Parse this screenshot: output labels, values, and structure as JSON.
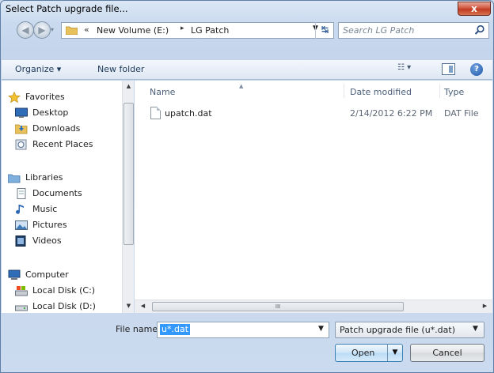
{
  "window": {
    "title": "Select Patch upgrade file...",
    "close_glyph": "x"
  },
  "nav": {
    "back_glyph": "◀",
    "forward_glyph": "▶",
    "address": {
      "overflow": "«",
      "segments": [
        "New Volume (E:)",
        "LG Patch"
      ],
      "separator": "▸"
    },
    "refresh_glyph": "↹",
    "search_placeholder": "Search LG Patch"
  },
  "toolbar": {
    "organize_label": "Organize ▾",
    "new_folder_label": "New folder",
    "views_glyph": "☷ ▾",
    "help_glyph": "?"
  },
  "sidebar": {
    "favorites": {
      "label": "Favorites",
      "items": [
        "Desktop",
        "Downloads",
        "Recent Places"
      ]
    },
    "libraries": {
      "label": "Libraries",
      "items": [
        "Documents",
        "Music",
        "Pictures",
        "Videos"
      ]
    },
    "computer": {
      "label": "Computer",
      "items": [
        "Local Disk (C:)",
        "Local Disk (D:)"
      ]
    }
  },
  "file_list": {
    "columns": {
      "name": "Name",
      "date": "Date modified",
      "type": "Type"
    },
    "rows": [
      {
        "name": "upatch.dat",
        "date": "2/14/2012 6:22 PM",
        "type": "DAT File"
      }
    ],
    "h_scroll_grip": "III"
  },
  "bottom": {
    "filename_label": "File name:",
    "filename_value": "u*.dat",
    "filter_value": "Patch upgrade file (u*.dat)",
    "open_label": "Open",
    "cancel_label": "Cancel"
  },
  "colors": {
    "selection": "#3399ff",
    "close_button": "#c13a22",
    "chrome": "#cbdaee"
  }
}
